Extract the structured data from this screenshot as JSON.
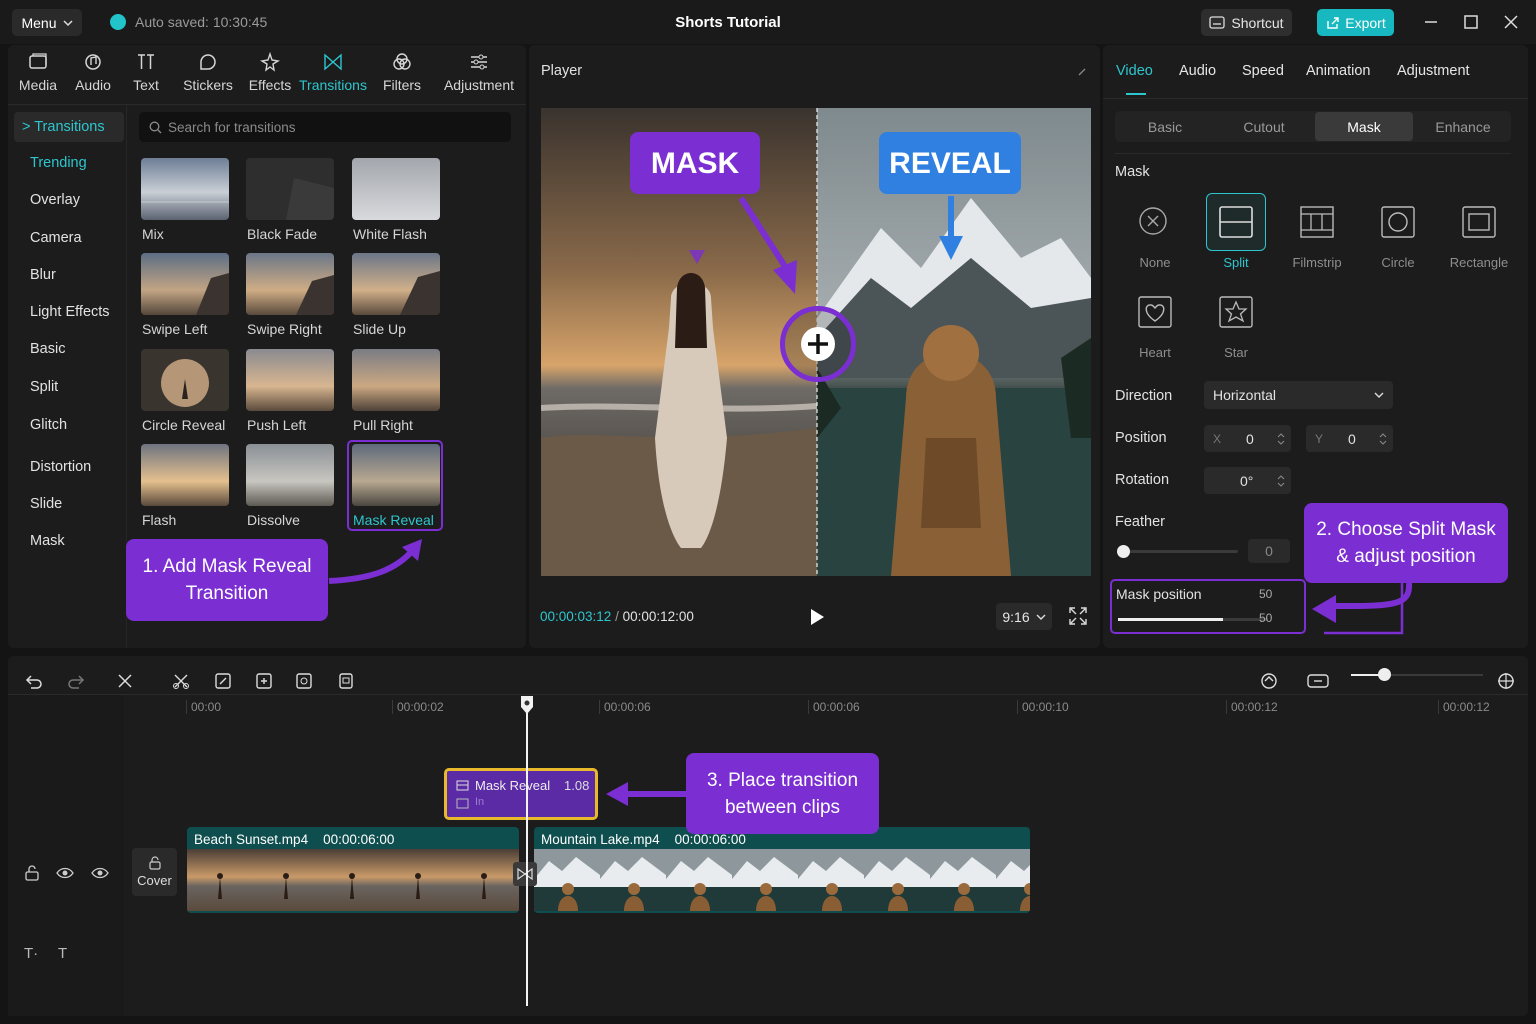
{
  "titlebar": {
    "menu_label": "Menu",
    "autosave": "Auto saved: 10:30:45",
    "title": "Shorts Tutorial",
    "shortcut_label": "Shortcut",
    "export_label": "Export"
  },
  "toolbar": {
    "tabs": [
      {
        "label": "Media",
        "icon": "media-icon"
      },
      {
        "label": "Audio",
        "icon": "audio-icon"
      },
      {
        "label": "Text",
        "icon": "text-icon"
      },
      {
        "label": "Stickers",
        "icon": "sticker-icon"
      },
      {
        "label": "Effects",
        "icon": "effects-icon"
      },
      {
        "label": "Transitions",
        "icon": "transitions-icon"
      },
      {
        "label": "Filters",
        "icon": "filters-icon"
      },
      {
        "label": "Adjustment",
        "icon": "adjustment-icon"
      }
    ],
    "active": "Transitions"
  },
  "sidebar": {
    "header": "> Transitions",
    "items": [
      "Trending",
      "Overlay",
      "Camera",
      "Blur",
      "Light Effects",
      "Basic",
      "Split",
      "Glitch",
      "Distortion",
      "Slide",
      "Mask"
    ],
    "active": "Trending"
  },
  "search": {
    "placeholder": "Search for transitions"
  },
  "transitions": [
    "Mix",
    "Black Fade",
    "White Flash",
    "Swipe Left",
    "Swipe Right",
    "Slide Up",
    "Circle Reveal",
    "Push Left",
    "Pull Right",
    "Flash",
    "Dissolve",
    "Mask Reveal"
  ],
  "selected_transition": "Mask Reveal",
  "callouts": {
    "step1": "1. Add Mask Reveal Transition",
    "step2": "2. Choose Split Mask & adjust position",
    "step3": "3. Place transition between clips"
  },
  "player": {
    "header": "Player",
    "mask_label": "MASK",
    "reveal_label": "REVEAL",
    "current_time": "00:00:03:12",
    "separator": "/",
    "total_time": "00:00:12:00",
    "aspect": "9:16",
    "colors": {
      "mask_purple": "#7b2ed1",
      "reveal_blue": "#2f80e0"
    }
  },
  "inspector": {
    "tabs": [
      "Video",
      "Audio",
      "Speed",
      "Animation",
      "Adjustment"
    ],
    "active_tab": "Video",
    "subtabs": [
      "Basic",
      "Cutout",
      "Mask",
      "Enhance"
    ],
    "active_subtab": "Mask",
    "mask_heading": "Mask",
    "masks": [
      {
        "label": "None",
        "icon": "none-icon"
      },
      {
        "label": "Split",
        "icon": "split-mask-icon"
      },
      {
        "label": "Filmstrip",
        "icon": "filmstrip-icon"
      },
      {
        "label": "Circle",
        "icon": "circle-mask-icon"
      },
      {
        "label": "Rectangle",
        "icon": "rectangle-mask-icon"
      },
      {
        "label": "Heart",
        "icon": "heart-mask-icon"
      },
      {
        "label": "Star",
        "icon": "star-mask-icon"
      }
    ],
    "active_mask": "Split",
    "direction_label": "Direction",
    "direction_value": "Horizontal",
    "position_label": "Position",
    "x_label": "X",
    "x_value": "0",
    "y_label": "Y",
    "y_value": "0",
    "rotation_label": "Rotation",
    "rotation_value": "0°",
    "feather_label": "Feather",
    "feather_value": "0",
    "feather_level": 0,
    "mask_position_label": "Mask position",
    "mask_position_value_1": "50",
    "mask_position_value_2": "50",
    "mask_position_level": 0.5
  },
  "timeline": {
    "ruler": [
      "00:00",
      "00:00:02",
      "00:00:06",
      "00:00:06",
      "00:00:10",
      "00:00:12",
      "00:00:12"
    ],
    "transition_clip": {
      "label": "Mask Reveal",
      "duration": "1.08",
      "sub": "In"
    },
    "clips": [
      {
        "name": "Beach Sunset.mp4",
        "duration": "00:00:06:00"
      },
      {
        "name": "Mountain Lake.mp4",
        "duration": "00:00:06:00"
      }
    ],
    "cover_label": "Cover",
    "zoom_level": 0.25
  }
}
